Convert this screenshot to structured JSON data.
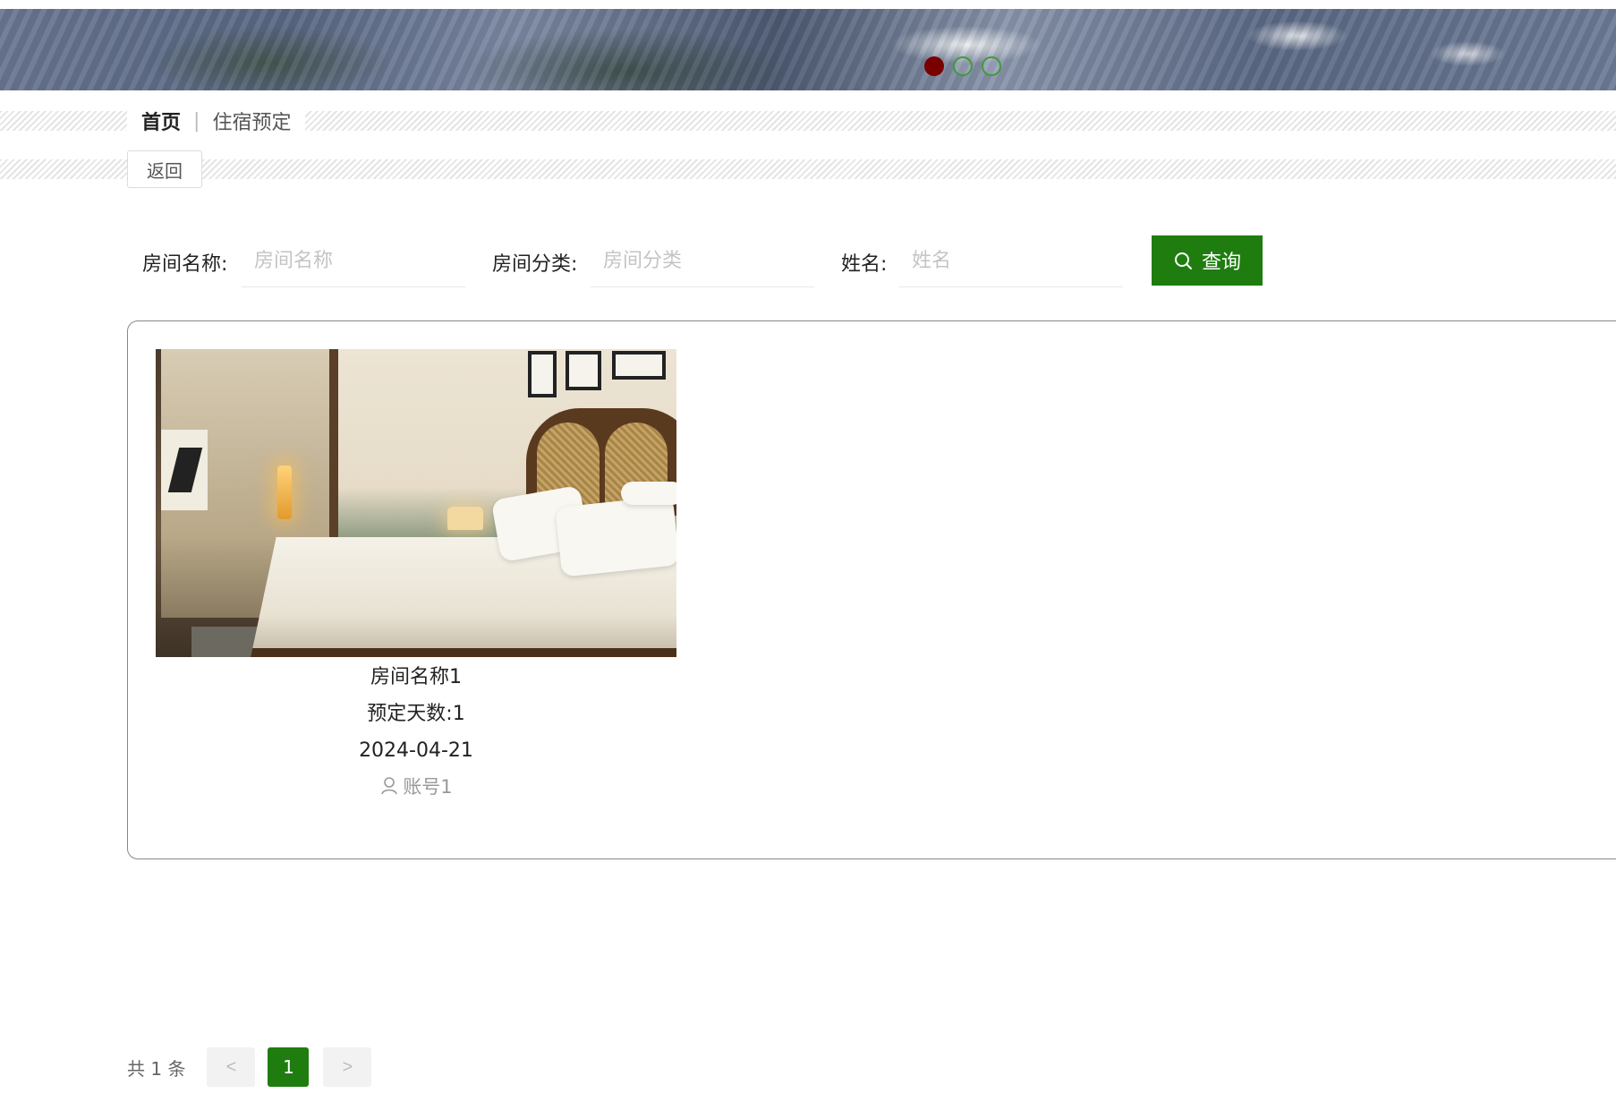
{
  "banner": {
    "slides": 3,
    "active_index": 0
  },
  "breadcrumb": {
    "home": "首页",
    "separator": "|",
    "current": "住宿预定"
  },
  "back_button": "返回",
  "search": {
    "fields": [
      {
        "label": "房间名称:",
        "placeholder": "房间名称",
        "value": ""
      },
      {
        "label": "房间分类:",
        "placeholder": "房间分类",
        "value": ""
      },
      {
        "label": "姓名:",
        "placeholder": "姓名",
        "value": ""
      }
    ],
    "button_label": "查询",
    "button_icon": "search-icon"
  },
  "results": [
    {
      "image": "hotel-room-photo",
      "room_name": "房间名称1",
      "days": "预定天数:1",
      "date": "2024-04-21",
      "account": "账号1",
      "account_icon": "user-icon"
    }
  ],
  "pagination": {
    "total_text": "共 1 条",
    "prev": "<",
    "current": "1",
    "next": ">"
  },
  "colors": {
    "accent": "#1f7d10",
    "dot_active": "#7a0000",
    "dot_idle_border": "#3f9a3a"
  }
}
